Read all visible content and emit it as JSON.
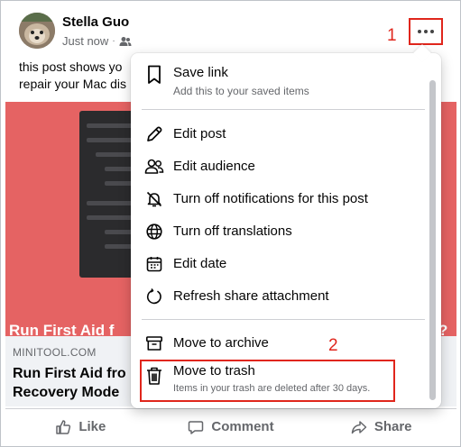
{
  "post": {
    "author": "Stella Guo",
    "time": "Just now",
    "text_line1": "this post shows yo",
    "text_line2": "repair your Mac dis"
  },
  "preview": {
    "headline": "Run First Aid f",
    "headline_end": "?",
    "domain": "MINITOOL.COM",
    "title_line1": "Run First Aid fro",
    "title_line2": "Recovery Mode"
  },
  "actions": {
    "like": "Like",
    "comment": "Comment",
    "share": "Share"
  },
  "annotations": {
    "step1": "1",
    "step2": "2",
    "highlight_color": "#e0261c"
  },
  "menu": {
    "save_link": "Save link",
    "save_link_sub": "Add this to your saved items",
    "edit_post": "Edit post",
    "edit_audience": "Edit audience",
    "turn_off_notifications": "Turn off notifications for this post",
    "turn_off_translations": "Turn off translations",
    "edit_date": "Edit date",
    "refresh_share": "Refresh share attachment",
    "move_archive": "Move to archive",
    "move_trash": "Move to trash",
    "move_trash_sub": "Items in your trash are deleted after 30 days."
  },
  "icons": {
    "more": "more-horizontal-icon",
    "privacy": "friends-icon",
    "like": "thumbs-up-icon",
    "comment": "comment-icon",
    "share": "share-arrow-icon"
  }
}
